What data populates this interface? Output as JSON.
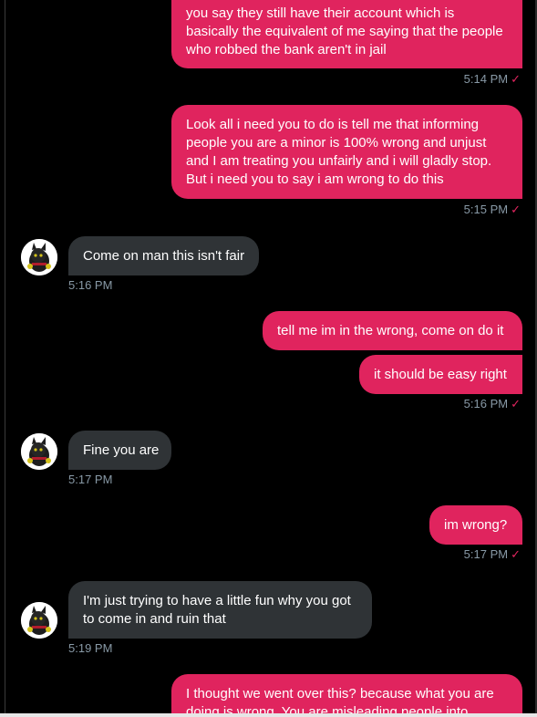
{
  "colors": {
    "outgoing": "#e0245e",
    "incoming": "#2f3336",
    "timestamp": "#8899a6",
    "background": "#000000"
  },
  "messages": [
    {
      "direction": "out",
      "text": "you say they still have their account which is basically the equivalent of me saying that the people who robbed the bank aren't in jail"
    },
    {
      "direction": "out",
      "text": "Look all i need you to do is tell me that informing people you are a minor is 100% wrong and unjust and I am treating you unfairly and i will gladly stop. But i need you to say i am wrong to do this"
    },
    {
      "direction": "in",
      "text": "Come on man this isn't fair"
    },
    {
      "direction": "out",
      "text": "tell me im in the wrong, come on do it"
    },
    {
      "direction": "out",
      "text": "it should be easy right"
    },
    {
      "direction": "in",
      "text": "Fine you are"
    },
    {
      "direction": "out",
      "text": "im wrong?"
    },
    {
      "direction": "in",
      "text": "I'm just trying to have a little fun why you got to come in and ruin that"
    },
    {
      "direction": "out",
      "text": "I thought we went over this? because what you are doing is wrong. You are misleading people into"
    }
  ],
  "timestamps": {
    "t1": "5:14 PM",
    "t2": "5:15 PM",
    "t3": "5:16 PM",
    "t4": "5:16 PM",
    "t5": "5:17 PM",
    "t6": "5:17 PM",
    "t7": "5:19 PM"
  },
  "read_mark": "✓"
}
